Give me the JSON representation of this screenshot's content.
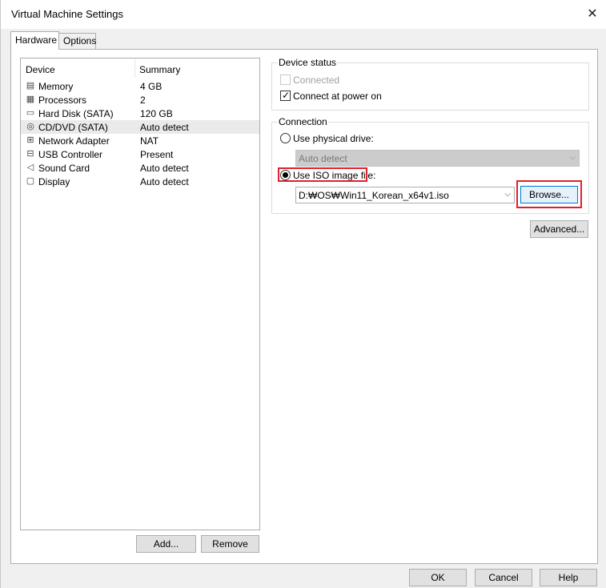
{
  "window": {
    "title": "Virtual Machine Settings",
    "close_glyph": "✕"
  },
  "tabs": [
    {
      "label": "Hardware",
      "active": true
    },
    {
      "label": "Options",
      "active": false
    }
  ],
  "device_list": {
    "columns": [
      "Device",
      "Summary"
    ],
    "rows": [
      {
        "icon": "memory-icon",
        "glyph": "▤",
        "device": "Memory",
        "summary": "4 GB",
        "selected": false
      },
      {
        "icon": "processor-icon",
        "glyph": "▦",
        "device": "Processors",
        "summary": "2",
        "selected": false
      },
      {
        "icon": "hard-disk-icon",
        "glyph": "▭",
        "device": "Hard Disk (SATA)",
        "summary": "120 GB",
        "selected": false
      },
      {
        "icon": "cd-dvd-icon",
        "glyph": "◎",
        "device": "CD/DVD (SATA)",
        "summary": "Auto detect",
        "selected": true
      },
      {
        "icon": "network-adapter-icon",
        "glyph": "⊞",
        "device": "Network Adapter",
        "summary": "NAT",
        "selected": false
      },
      {
        "icon": "usb-controller-icon",
        "glyph": "⊟",
        "device": "USB Controller",
        "summary": "Present",
        "selected": false
      },
      {
        "icon": "sound-card-icon",
        "glyph": "◁",
        "device": "Sound Card",
        "summary": "Auto detect",
        "selected": false
      },
      {
        "icon": "display-icon",
        "glyph": "▢",
        "device": "Display",
        "summary": "Auto detect",
        "selected": false
      }
    ]
  },
  "list_buttons": {
    "add": "Add...",
    "remove": "Remove"
  },
  "device_status": {
    "label": "Device status",
    "connected_label": "Connected",
    "connected_checked": false,
    "connected_enabled": false,
    "power_on_label": "Connect at power on",
    "power_on_checked": true,
    "check_glyph": "✓"
  },
  "connection": {
    "label": "Connection",
    "physical_label": "Use physical drive:",
    "physical_selected": false,
    "physical_value": "Auto detect",
    "iso_label": "Use ISO image file:",
    "iso_selected": true,
    "iso_value": "D:₩OS₩Win11_Korean_x64v1.iso",
    "browse_label": "Browse...",
    "chevron_glyph": "⌵"
  },
  "advanced_label": "Advanced...",
  "dialog_buttons": {
    "ok": "OK",
    "cancel": "Cancel",
    "help": "Help"
  },
  "colors": {
    "highlight": "#e0202a",
    "selection": "#eaeaea"
  }
}
